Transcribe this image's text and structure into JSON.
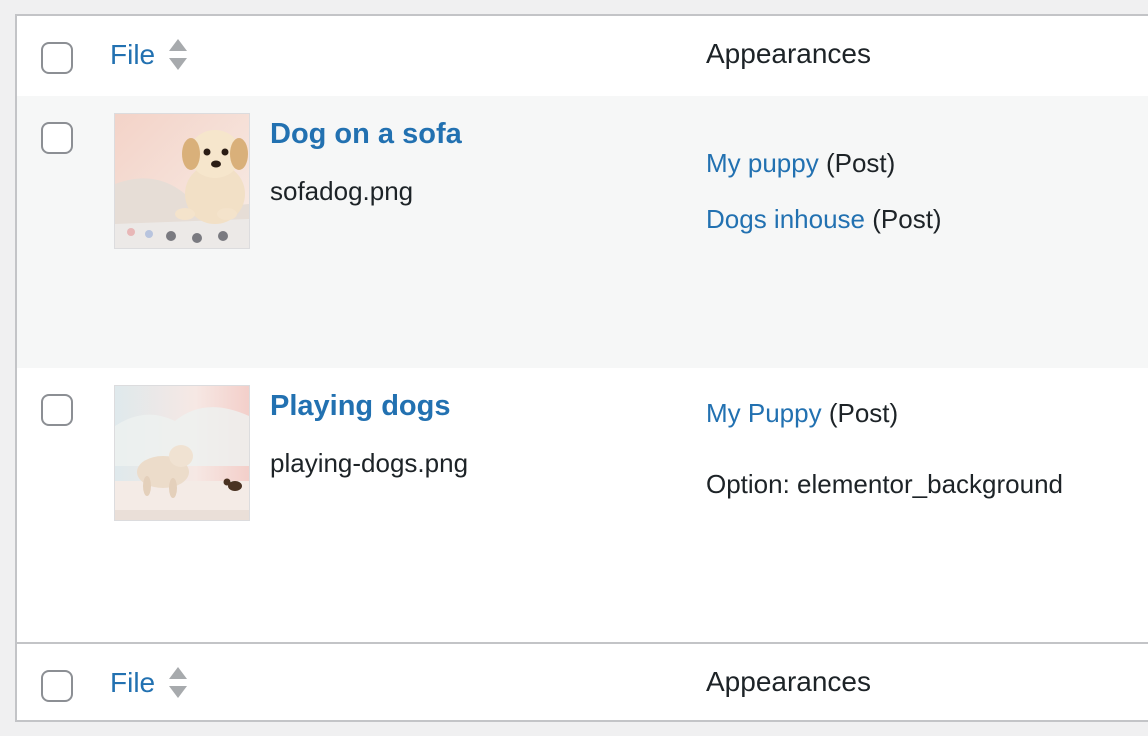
{
  "header": {
    "file_label": "File",
    "appearances_label": "Appearances"
  },
  "footer": {
    "file_label": "File",
    "appearances_label": "Appearances"
  },
  "rows": [
    {
      "title": "Dog on a sofa",
      "filename": "sofadog.png",
      "appearances": [
        {
          "link": "My puppy",
          "type": "(Post)"
        },
        {
          "link": "Dogs inhouse",
          "type": "(Post)"
        }
      ]
    },
    {
      "title": "Playing dogs",
      "filename": "playing-dogs.png",
      "appearances": [
        {
          "link": "My Puppy",
          "type": "(Post)"
        },
        {
          "text": "Option: elementor_background"
        }
      ]
    }
  ],
  "colors": {
    "link": "#2271b1",
    "border": "#c3c4c7",
    "row_alt": "#f6f7f7"
  },
  "icons": {
    "sort": "sort-arrows-icon",
    "checkbox": "checkbox"
  }
}
